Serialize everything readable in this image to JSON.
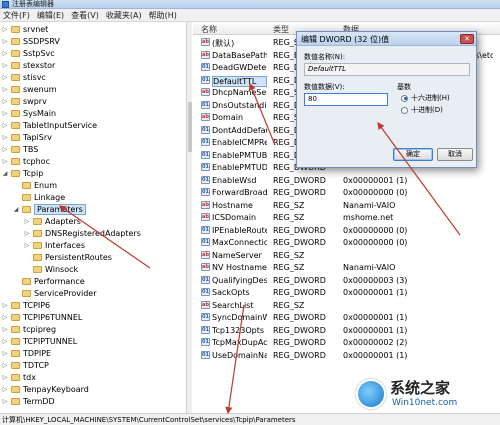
{
  "window": {
    "title": "注册表编辑器"
  },
  "menubar": [
    "文件(F)",
    "编辑(E)",
    "查看(V)",
    "收藏夹(A)",
    "帮助(H)"
  ],
  "tree": [
    {
      "label": "srvnet",
      "indent": 0,
      "expander": "▷"
    },
    {
      "label": "SSDPSRV",
      "indent": 0,
      "expander": "▷"
    },
    {
      "label": "SstpSvc",
      "indent": 0,
      "expander": "▷"
    },
    {
      "label": "stexstor",
      "indent": 0,
      "expander": "▷"
    },
    {
      "label": "stisvc",
      "indent": 0,
      "expander": "▷"
    },
    {
      "label": "swenum",
      "indent": 0,
      "expander": "▷"
    },
    {
      "label": "swprv",
      "indent": 0,
      "expander": "▷"
    },
    {
      "label": "SysMain",
      "indent": 0,
      "expander": "▷"
    },
    {
      "label": "TabletInputService",
      "indent": 0,
      "expander": "▷"
    },
    {
      "label": "TapiSrv",
      "indent": 0,
      "expander": "▷"
    },
    {
      "label": "TBS",
      "indent": 0,
      "expander": "▷"
    },
    {
      "label": "tcphoc",
      "indent": 0,
      "expander": "▷"
    },
    {
      "label": "Tcpip",
      "indent": 0,
      "expander": "◢"
    },
    {
      "label": "Enum",
      "indent": 1,
      "expander": ""
    },
    {
      "label": "Linkage",
      "indent": 1,
      "expander": ""
    },
    {
      "label": "Parameters",
      "indent": 1,
      "expander": "◢"
    },
    {
      "label": "Adapters",
      "indent": 2,
      "expander": "▷"
    },
    {
      "label": "DNSRegisteredAdapters",
      "indent": 2,
      "expander": "▷"
    },
    {
      "label": "Interfaces",
      "indent": 2,
      "expander": "▷"
    },
    {
      "label": "PersistentRoutes",
      "indent": 2,
      "expander": ""
    },
    {
      "label": "Winsock",
      "indent": 2,
      "expander": ""
    },
    {
      "label": "Performance",
      "indent": 1,
      "expander": ""
    },
    {
      "label": "ServiceProvider",
      "indent": 1,
      "expander": ""
    },
    {
      "label": "TCPIP6",
      "indent": 0,
      "expander": "▷"
    },
    {
      "label": "TCPIP6TUNNEL",
      "indent": 0,
      "expander": "▷"
    },
    {
      "label": "tcpipreg",
      "indent": 0,
      "expander": "▷"
    },
    {
      "label": "TCPIPTUNNEL",
      "indent": 0,
      "expander": "▷"
    },
    {
      "label": "TDPIPE",
      "indent": 0,
      "expander": "▷"
    },
    {
      "label": "TDTCP",
      "indent": 0,
      "expander": "▷"
    },
    {
      "label": "tdx",
      "indent": 0,
      "expander": "▷"
    },
    {
      "label": "TenpayKeyboard",
      "indent": 0,
      "expander": "▷"
    },
    {
      "label": "TermDD",
      "indent": 0,
      "expander": "▷"
    }
  ],
  "list": {
    "headers": {
      "name": "名称",
      "type": "类型",
      "data": "数据"
    },
    "rows": [
      {
        "icon": "ab",
        "name": "(默认)",
        "type": "REG_SZ",
        "data": "(数值未设置)"
      },
      {
        "icon": "ab",
        "name": "DataBasePath",
        "type": "REG_EXPAND_SZ",
        "data": "%SystemRoot%\\System32\\drivers\\etc"
      },
      {
        "icon": "01",
        "name": "DeadGWDetec...",
        "type": "REG_DWORD",
        "data": ""
      },
      {
        "icon": "01",
        "name": "DefaultTTL",
        "type": "REG_DWORD",
        "data": ""
      },
      {
        "icon": "ab",
        "name": "DhcpNameSer...",
        "type": "REG_SZ",
        "data": ""
      },
      {
        "icon": "01",
        "name": "DnsOutstandin...",
        "type": "REG_DWORD",
        "data": ""
      },
      {
        "icon": "ab",
        "name": "Domain",
        "type": "REG_SZ",
        "data": ""
      },
      {
        "icon": "01",
        "name": "DontAddDefau...",
        "type": "REG_DWORD",
        "data": ""
      },
      {
        "icon": "01",
        "name": "EnableICMPRe...",
        "type": "REG_DWORD",
        "data": ""
      },
      {
        "icon": "01",
        "name": "EnablePMTUBl...",
        "type": "REG_DWORD",
        "data": ""
      },
      {
        "icon": "01",
        "name": "EnablePMTUDi...",
        "type": "REG_DWORD",
        "data": ""
      },
      {
        "icon": "01",
        "name": "EnableWsd",
        "type": "REG_DWORD",
        "data": "0x00000001 (1)"
      },
      {
        "icon": "01",
        "name": "ForwardBroad...",
        "type": "REG_DWORD",
        "data": "0x00000000 (0)"
      },
      {
        "icon": "ab",
        "name": "Hostname",
        "type": "REG_SZ",
        "data": "Nanami-VAIO"
      },
      {
        "icon": "ab",
        "name": "ICSDomain",
        "type": "REG_SZ",
        "data": "mshome.net"
      },
      {
        "icon": "01",
        "name": "IPEnableRouter",
        "type": "REG_DWORD",
        "data": "0x00000000 (0)"
      },
      {
        "icon": "01",
        "name": "MaxConnectio...",
        "type": "REG_DWORD",
        "data": "0x00000000 (0)"
      },
      {
        "icon": "ab",
        "name": "NameServer",
        "type": "REG_SZ",
        "data": ""
      },
      {
        "icon": "ab",
        "name": "NV Hostname",
        "type": "REG_SZ",
        "data": "Nanami-VAIO"
      },
      {
        "icon": "01",
        "name": "QualifyingDesti...",
        "type": "REG_DWORD",
        "data": "0x00000003 (3)"
      },
      {
        "icon": "01",
        "name": "SackOpts",
        "type": "REG_DWORD",
        "data": "0x00000001 (1)"
      },
      {
        "icon": "ab",
        "name": "SearchList",
        "type": "REG_SZ",
        "data": ""
      },
      {
        "icon": "01",
        "name": "SyncDomainWi...",
        "type": "REG_DWORD",
        "data": "0x00000001 (1)"
      },
      {
        "icon": "01",
        "name": "Tcp1323Opts",
        "type": "REG_DWORD",
        "data": "0x00000001 (1)"
      },
      {
        "icon": "01",
        "name": "TcpMaxDupAc...",
        "type": "REG_DWORD",
        "data": "0x00000002 (2)"
      },
      {
        "icon": "01",
        "name": "UseDomainNa...",
        "type": "REG_DWORD",
        "data": "0x00000001 (1)"
      }
    ]
  },
  "statusbar": {
    "path": "计算机\\HKEY_LOCAL_MACHINE\\SYSTEM\\CurrentControlSet\\services\\Tcpip\\Parameters"
  },
  "dialog": {
    "title": "编辑 DWORD (32 位)值",
    "close_glyph": "✕",
    "name_label": "数值名称(N):",
    "name_value": "DefaultTTL",
    "data_label": "数值数据(V):",
    "data_value": "80",
    "base_label": "基数",
    "hex_label": "十六进制(H)",
    "dec_label": "十进制(D)",
    "ok_label": "确定",
    "cancel_label": "取消"
  },
  "watermark": {
    "title": "系统之家",
    "subtitle": "Win10net.com"
  },
  "colors": {
    "arrow": "#c0392b",
    "selection": "#cfe3f8",
    "accent": "#1e5bb8"
  }
}
